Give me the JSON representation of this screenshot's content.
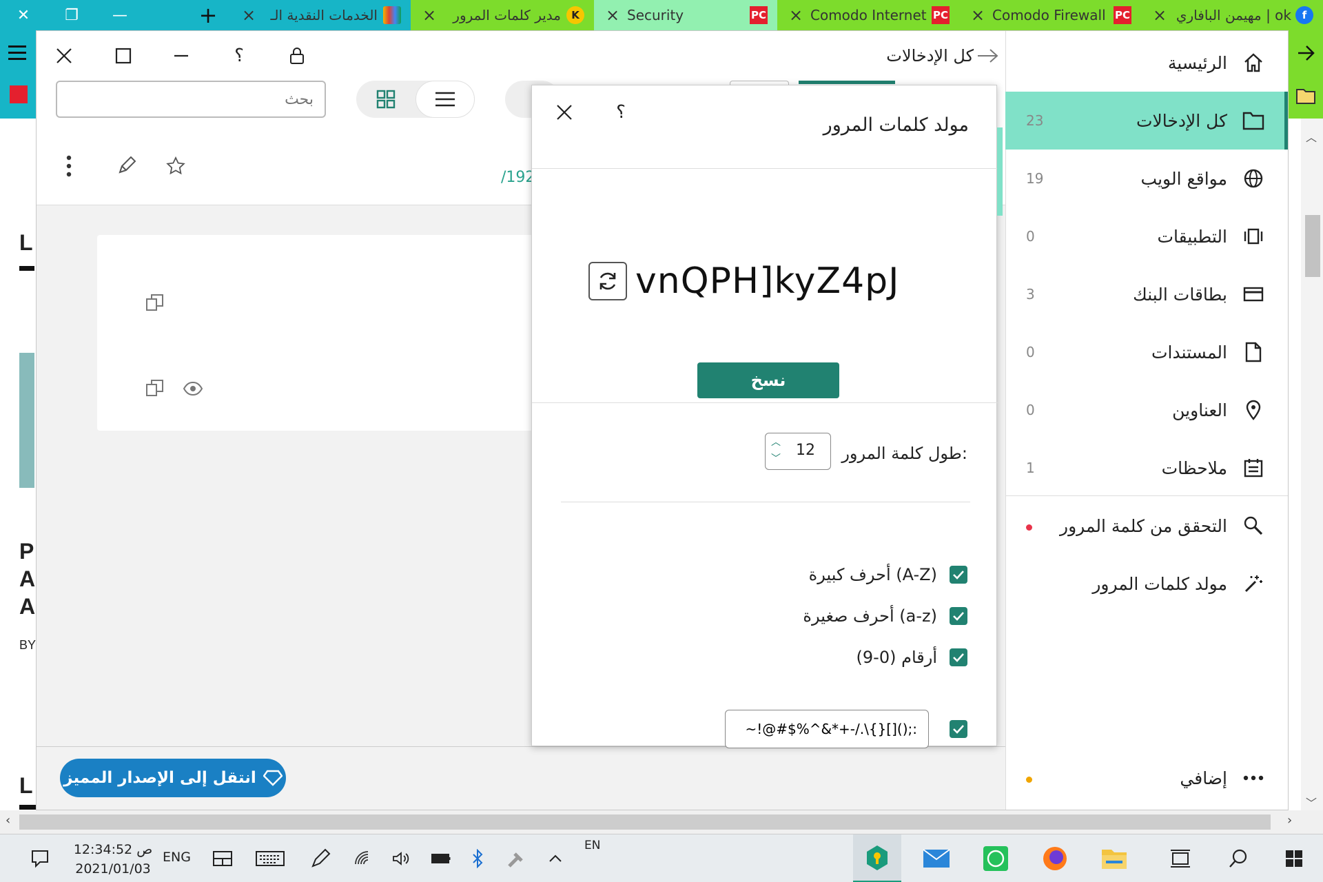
{
  "browser": {
    "tabs": [
      {
        "title": "مهيمن البافاري | ok",
        "favicon": "facebook-icon",
        "color": "#7ddc2c"
      },
      {
        "title": "Comodo Firewall",
        "favicon": "pcmag-icon",
        "color": "#7ddc2c"
      },
      {
        "title": "Comodo Internet",
        "favicon": "pcmag-icon",
        "color": "#7ddc2c"
      },
      {
        "title": "Security",
        "favicon": "pcmag-icon",
        "color": "#92f0b0"
      },
      {
        "title": "مدير كلمات المرور",
        "favicon": "kaspersky-icon",
        "color": "#7ddc2c"
      },
      {
        "title": "الخدمات النقدية الـ",
        "favicon": "shop-icon",
        "color": "#17b5c7"
      }
    ],
    "bg_page_fragments": [
      "L",
      "P",
      "A",
      "A",
      "BY",
      "L"
    ]
  },
  "app": {
    "back_title": "كل الإدخالات",
    "search_placeholder": "بحث",
    "url_fragment": "/192",
    "premium_label": "انتقل إلى الإصدار المميز",
    "sidebar": {
      "items": [
        {
          "label": "الرئيسية",
          "count": "",
          "icon": "home-icon"
        },
        {
          "label": "كل الإدخالات",
          "count": "23",
          "icon": "folder-icon"
        },
        {
          "label": "مواقع الويب",
          "count": "19",
          "icon": "globe-icon"
        },
        {
          "label": "التطبيقات",
          "count": "0",
          "icon": "apps-icon"
        },
        {
          "label": "بطاقات البنك",
          "count": "3",
          "icon": "card-icon"
        },
        {
          "label": "المستندات",
          "count": "0",
          "icon": "document-icon"
        },
        {
          "label": "العناوين",
          "count": "0",
          "icon": "pin-icon"
        },
        {
          "label": "ملاحظات",
          "count": "1",
          "icon": "notes-icon"
        }
      ],
      "tools": [
        {
          "label": "التحقق من كلمة المرور",
          "icon": "key-search-icon",
          "dot": "#e8334a"
        },
        {
          "label": "مولد كلمات المرور",
          "icon": "magic-wand-icon"
        }
      ],
      "more": {
        "label": "إضافي",
        "icon": "more-icon",
        "dot": "#f0a500"
      }
    }
  },
  "generator": {
    "title": "مولد كلمات المرور",
    "help": "؟",
    "password": "vnQPH]kyZ4pJ",
    "copy_label": "نسخ",
    "length_label": "طول كلمة المرور:",
    "length_value": "12",
    "options": [
      {
        "label": "أحرف كبيرة (A-Z)",
        "checked": true
      },
      {
        "label": "أحرف صغيرة (a-z)",
        "checked": true
      },
      {
        "label": "أرقام (0-9)",
        "checked": true
      }
    ],
    "special_chars": "~!@#$%^&*+-/.\\{}[]();:",
    "special_checked": true,
    "accent": "#218271"
  },
  "taskbar": {
    "time": "12:34:52 ص",
    "date": "2021/01/03",
    "lang": "ENG",
    "ime": "EN"
  }
}
